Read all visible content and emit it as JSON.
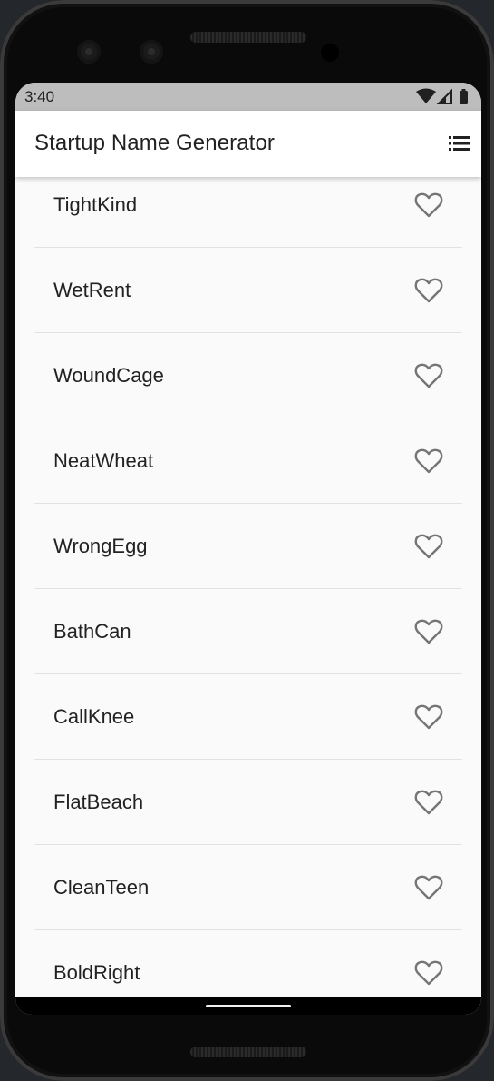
{
  "status_bar": {
    "time": "3:40",
    "icons": [
      "wifi-icon",
      "signal-icon",
      "battery-icon"
    ]
  },
  "app_bar": {
    "title": "Startup Name Generator",
    "action_icon": "list-icon"
  },
  "list": {
    "items": [
      {
        "name": "TightKind",
        "favorited": false
      },
      {
        "name": "WetRent",
        "favorited": false
      },
      {
        "name": "WoundCage",
        "favorited": false
      },
      {
        "name": "NeatWheat",
        "favorited": false
      },
      {
        "name": "WrongEgg",
        "favorited": false
      },
      {
        "name": "BathCan",
        "favorited": false
      },
      {
        "name": "CallKnee",
        "favorited": false
      },
      {
        "name": "FlatBeach",
        "favorited": false
      },
      {
        "name": "CleanTeen",
        "favorited": false
      },
      {
        "name": "BoldRight",
        "favorited": false
      }
    ],
    "favorite_icon": "heart-outline-icon"
  },
  "colors": {
    "app_bar_bg": "#ffffff",
    "status_bar_bg": "#bdbdbd",
    "list_bg": "#fafafa",
    "heart": "#757575"
  }
}
